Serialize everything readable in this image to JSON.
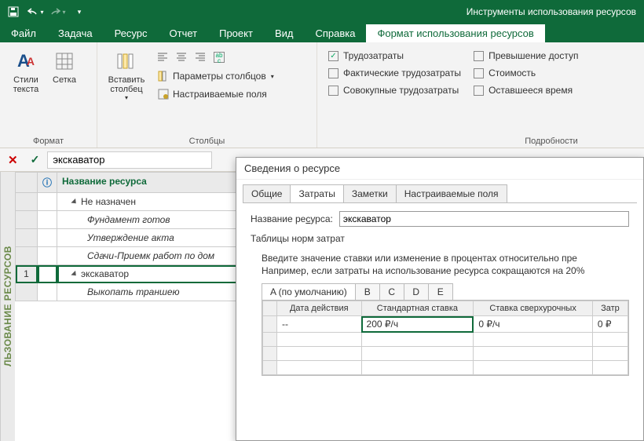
{
  "titlebar": {
    "tool_title": "Инструменты использования ресурсов"
  },
  "tabs": {
    "file": "Файл",
    "task": "Задача",
    "resource": "Ресурс",
    "report": "Отчет",
    "project": "Проект",
    "view": "Вид",
    "help": "Справка",
    "format": "Формат использования ресурсов"
  },
  "ribbon": {
    "group_format": "Формат",
    "group_columns": "Столбцы",
    "group_details": "Подробности",
    "text_styles": "Стили текста",
    "grid": "Сетка",
    "insert_column": "Вставить столбец",
    "column_params": "Параметры столбцов",
    "custom_fields": "Настраиваемые поля",
    "chk_work": "Трудозатраты",
    "chk_actual": "Фактические трудозатраты",
    "chk_cumulative": "Совокупные трудозатраты",
    "chk_overalloc": "Превышение доступ",
    "chk_cost": "Стоимость",
    "chk_remaining": "Оставшееся время"
  },
  "search": {
    "value": "экскаватор"
  },
  "sidelabel": "ЛЬЗОВАНИЕ РЕСУРСОВ",
  "sheet": {
    "col_info_icon": "ⓘ",
    "col_name": "Название ресурса",
    "rows": {
      "unassigned": "Не назначен",
      "foundation": "Фундамент готов",
      "approval": "Утверждение акта",
      "acceptance": "Сдачи-Приемк работ по дом",
      "excavator_num": "1",
      "excavator": "экскаватор",
      "dig": "Выкопать траншею"
    }
  },
  "dialog": {
    "title": "Сведения о ресурсе",
    "tabs": {
      "general": "Общие",
      "costs": "Затраты",
      "notes": "Заметки",
      "custom": "Настраиваемые поля"
    },
    "name_label_pre": "Название ре",
    "name_label_und": "с",
    "name_label_post": "урса:",
    "name_value": "экскаватор",
    "tables_label_und": "Т",
    "tables_label_post": "аблицы норм затрат",
    "hint1": "Введите значение ставки или изменение в процентах относительно пре",
    "hint2": "Например, если затраты на использование ресурса сокращаются на 20%",
    "subtabs": {
      "a": "A (по умолчанию)",
      "b": "B",
      "c": "C",
      "d": "D",
      "e": "E"
    },
    "rate_cols": {
      "date": "Дата действия",
      "std": "Стандартная ставка",
      "ovt": "Ставка сверхурочных",
      "per": "Затр"
    },
    "rate_rows": {
      "r0_date": "--",
      "r0_std": "200 ₽/ч",
      "r0_ovt": "0 ₽/ч",
      "r0_per": "0 ₽"
    }
  },
  "chart_data": null
}
